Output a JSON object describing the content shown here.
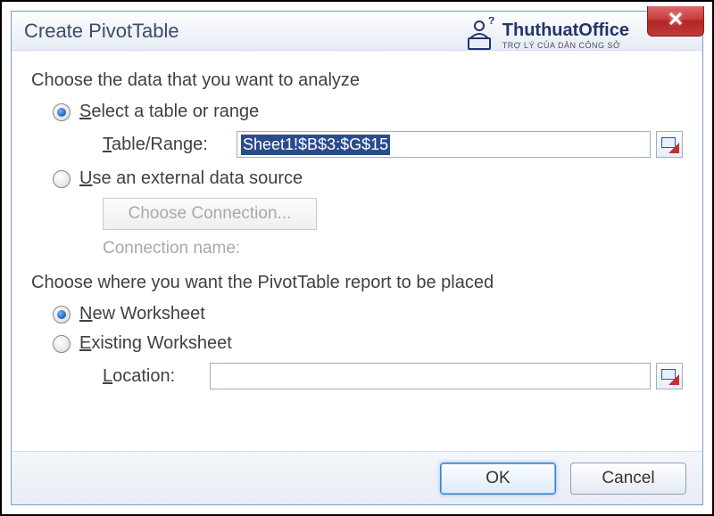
{
  "dialog": {
    "title": "Create PivotTable",
    "close_glyph": "✕"
  },
  "section1": {
    "heading": "Choose the data that you want to analyze",
    "opt_range": {
      "prefix": "S",
      "rest": "elect a table or range",
      "checked": true
    },
    "range_field": {
      "label_prefix": "T",
      "label_rest": "able/Range:",
      "value": "Sheet1!$B$3:$G$15"
    },
    "opt_external": {
      "prefix": "U",
      "rest": "se an external data source",
      "checked": false
    },
    "choose_conn": "Choose Connection...",
    "conn_name_label": "Connection name:"
  },
  "section2": {
    "heading": "Choose where you want the PivotTable report to be placed",
    "opt_new": {
      "prefix": "N",
      "rest": "ew Worksheet",
      "checked": true
    },
    "opt_existing": {
      "prefix": "E",
      "rest": "xisting Worksheet",
      "checked": false
    },
    "location_field": {
      "label_prefix": "L",
      "label_rest": "ocation:",
      "value": ""
    }
  },
  "buttons": {
    "ok": "OK",
    "cancel": "Cancel"
  },
  "watermark": {
    "text": "ThuthuatOffice",
    "sub": "TRỢ LÝ CỦA DÂN CÔNG SỞ"
  }
}
